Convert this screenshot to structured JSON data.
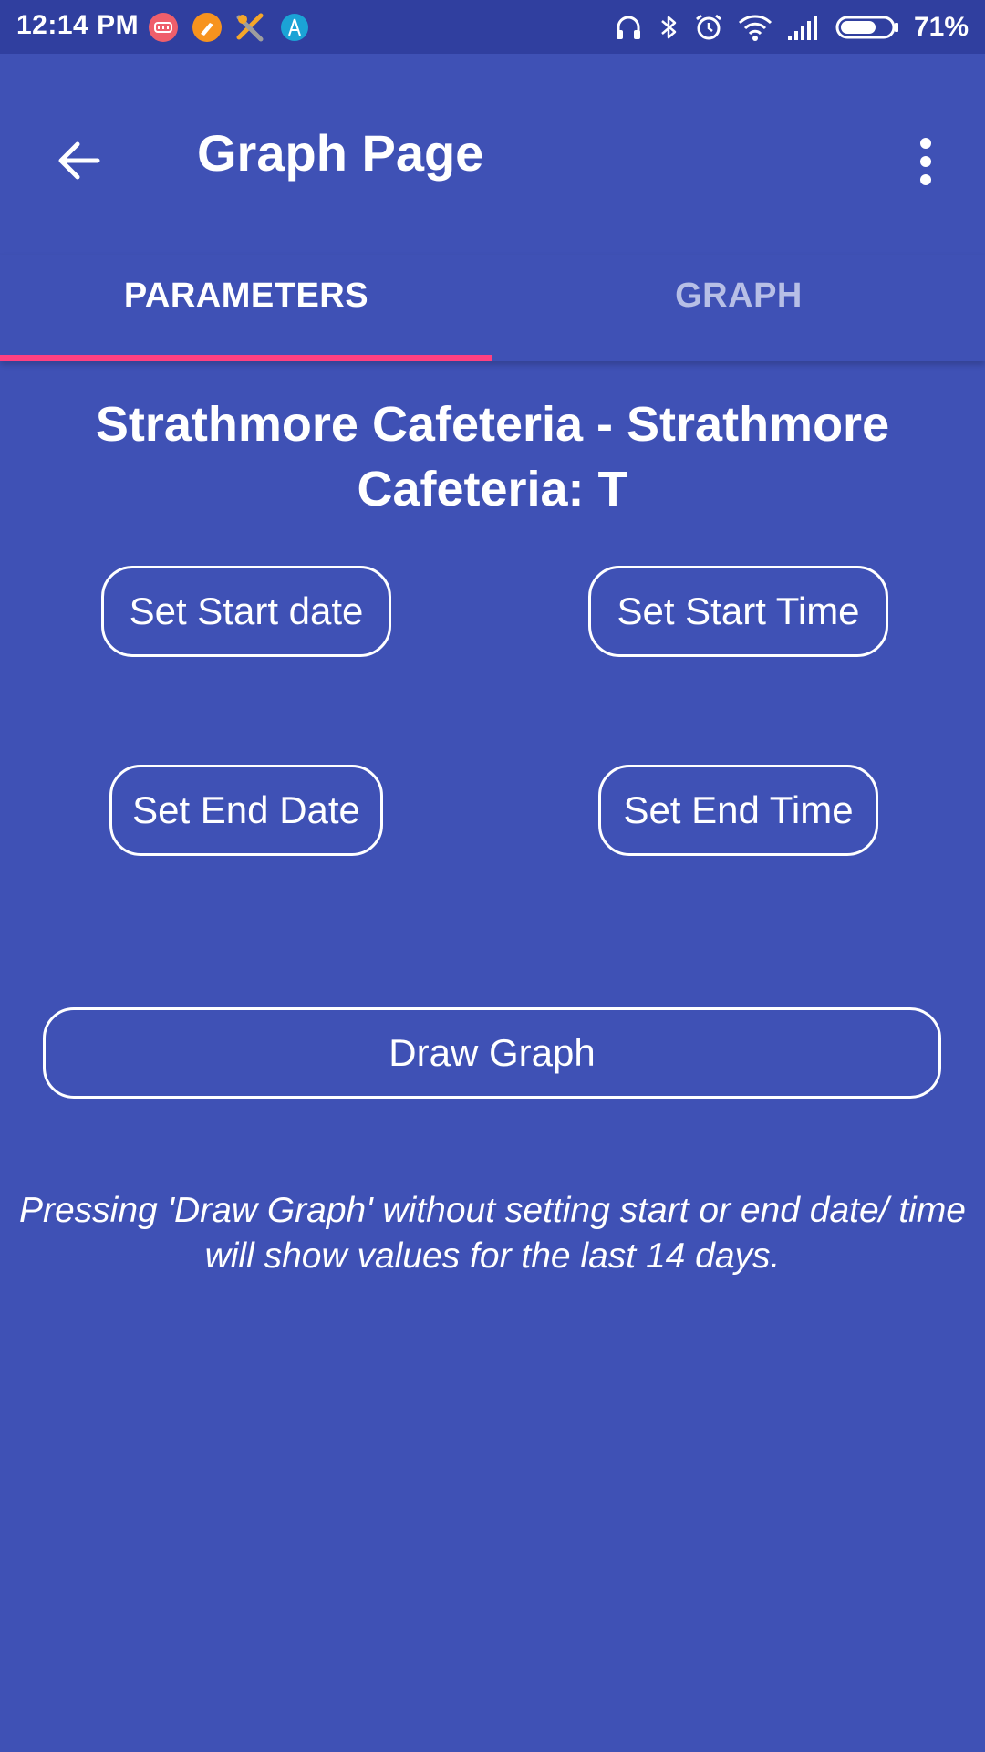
{
  "status_bar": {
    "time": "12:14 PM",
    "battery_percent": "71%",
    "battery_level": 0.71,
    "notification_icons": [
      "pocket-app-icon",
      "paint-brush-icon",
      "tools-icon",
      "antenna-app-icon"
    ],
    "system_icons": [
      "headphones-icon",
      "bluetooth-icon",
      "alarm-icon",
      "wifi-icon",
      "signal-icon",
      "battery-icon"
    ]
  },
  "toolbar": {
    "title": "Graph Page",
    "back_icon": "arrow-back-icon",
    "menu_icon": "more-vert-icon"
  },
  "tabs": [
    {
      "label": "PARAMETERS",
      "selected": true
    },
    {
      "label": "GRAPH",
      "selected": false
    }
  ],
  "main": {
    "heading": "Strathmore Cafeteria - Strathmore Cafeteria: T",
    "buttons": {
      "start_date": "Set Start date",
      "start_time": "Set Start Time",
      "end_date": "Set End Date",
      "end_time": "Set End Time",
      "draw_graph": "Draw Graph"
    },
    "hint": "Pressing 'Draw Graph' without setting start or end date/ time will show values for the last 14 days."
  },
  "colors": {
    "primary": "#3f51b5",
    "primary_dark": "#303f9f",
    "accent": "#ff4081"
  }
}
